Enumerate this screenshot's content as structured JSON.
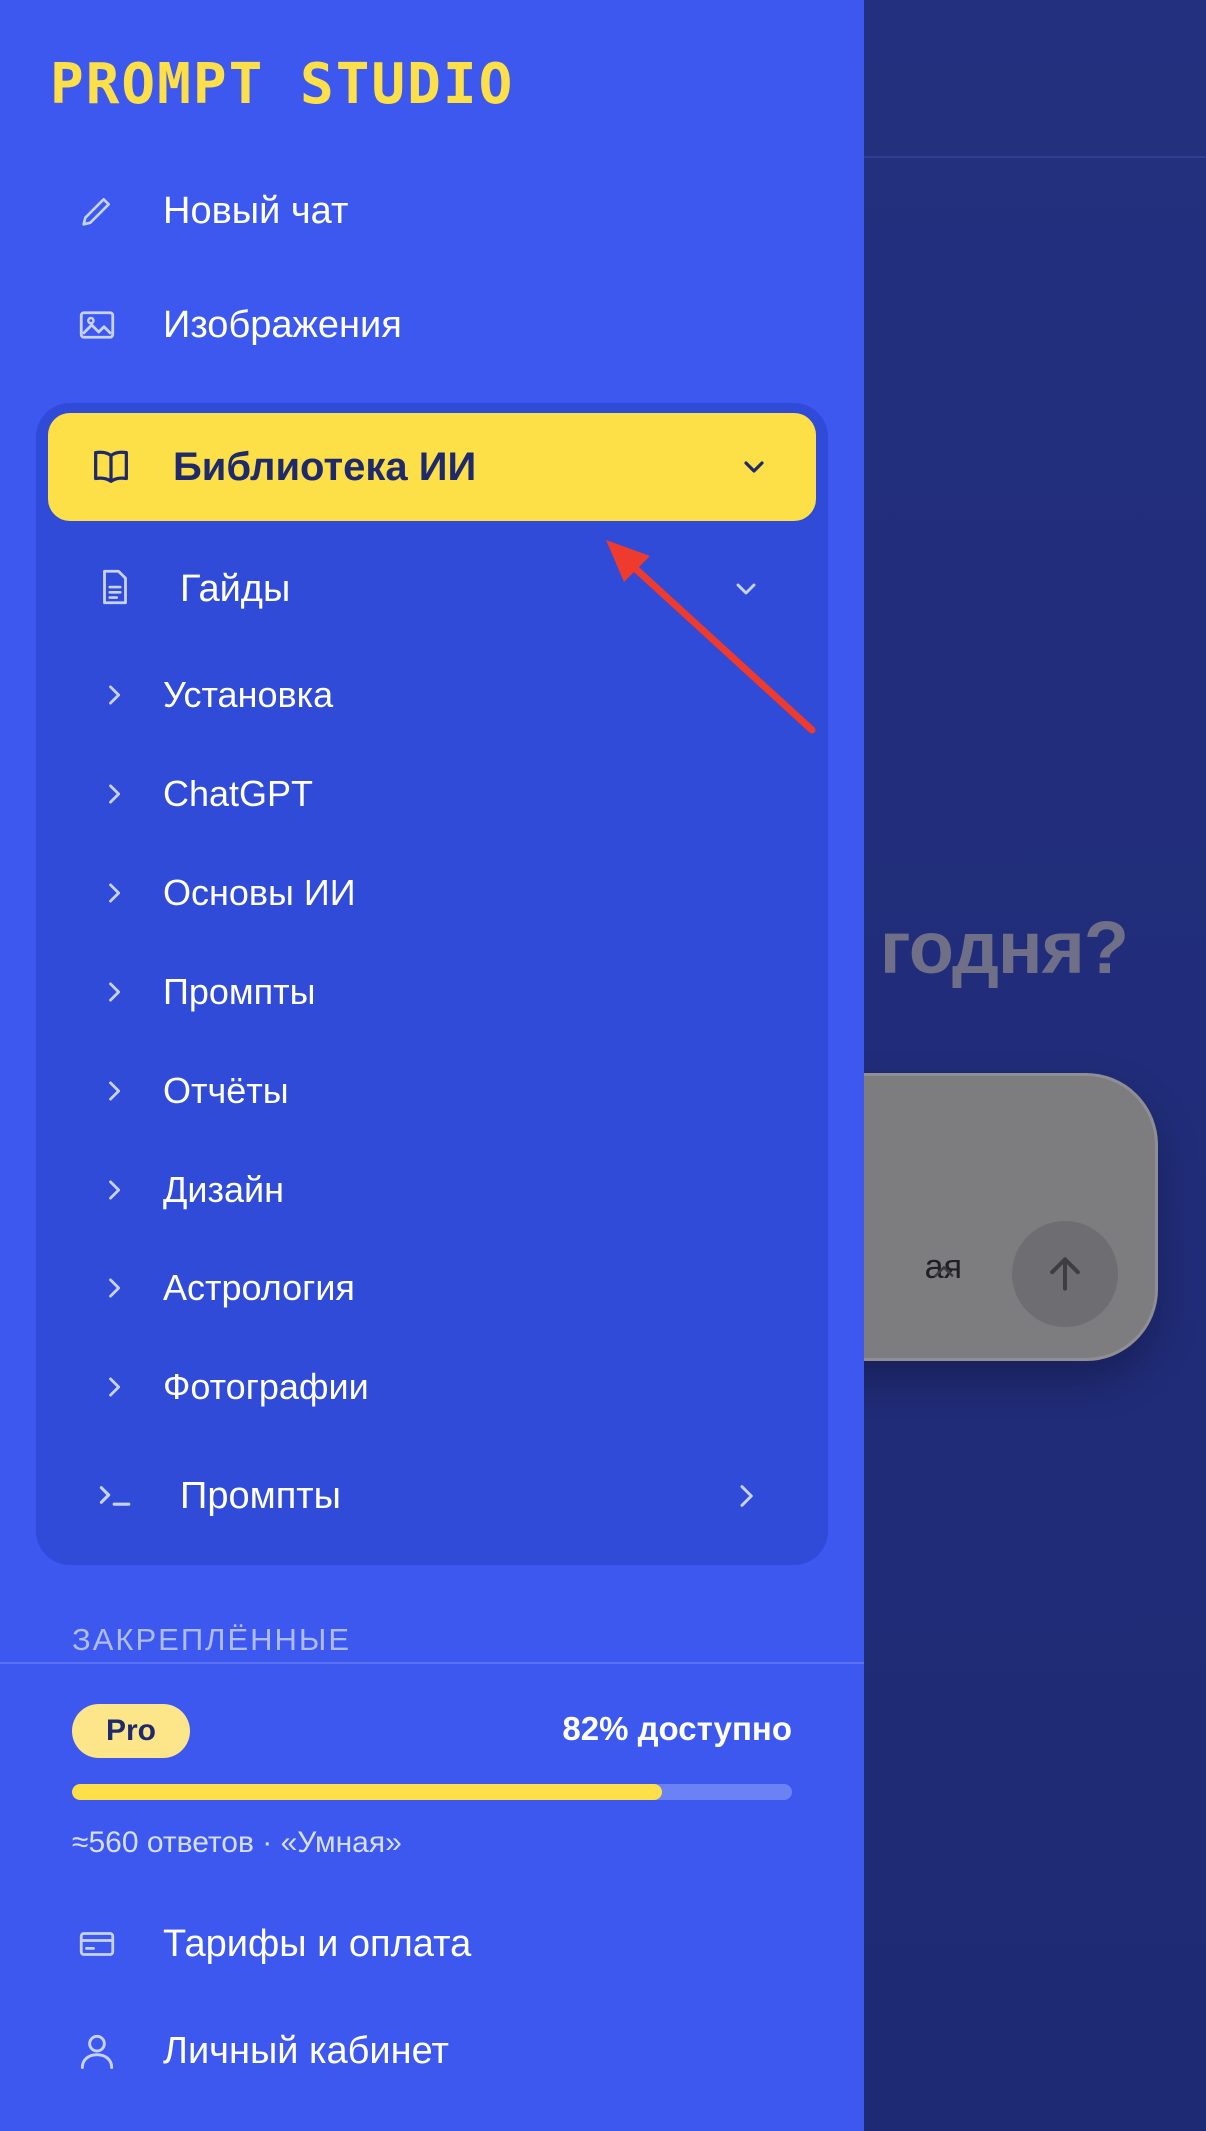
{
  "app": {
    "logo": "PROMPT STUDIO"
  },
  "nav": {
    "new_chat": "Новый чат",
    "images": "Изображения"
  },
  "library": {
    "title": "Библиотека ИИ",
    "guides": {
      "title": "Гайды",
      "items": [
        "Установка",
        "ChatGPT",
        "Основы ИИ",
        "Промпты",
        "Отчёты",
        "Дизайн",
        "Астрология",
        "Фотографии"
      ]
    },
    "prompts": "Промпты"
  },
  "pinned": {
    "label": "ЗАКРЕПЛЁННЫЕ"
  },
  "plan": {
    "badge": "Pro",
    "quota_text": "82% доступно",
    "quota_fraction": 0.82,
    "sub": "≈560 ответов · «Умная»"
  },
  "footer": {
    "billing": "Тарифы и оплата",
    "account": "Личный кабинет"
  },
  "main": {
    "heading_fragment": "годня?",
    "model_fragment": "ая"
  },
  "colors": {
    "sidebar": "#3d58ef",
    "accent": "#fde047",
    "panel": "#2f4bd7"
  }
}
